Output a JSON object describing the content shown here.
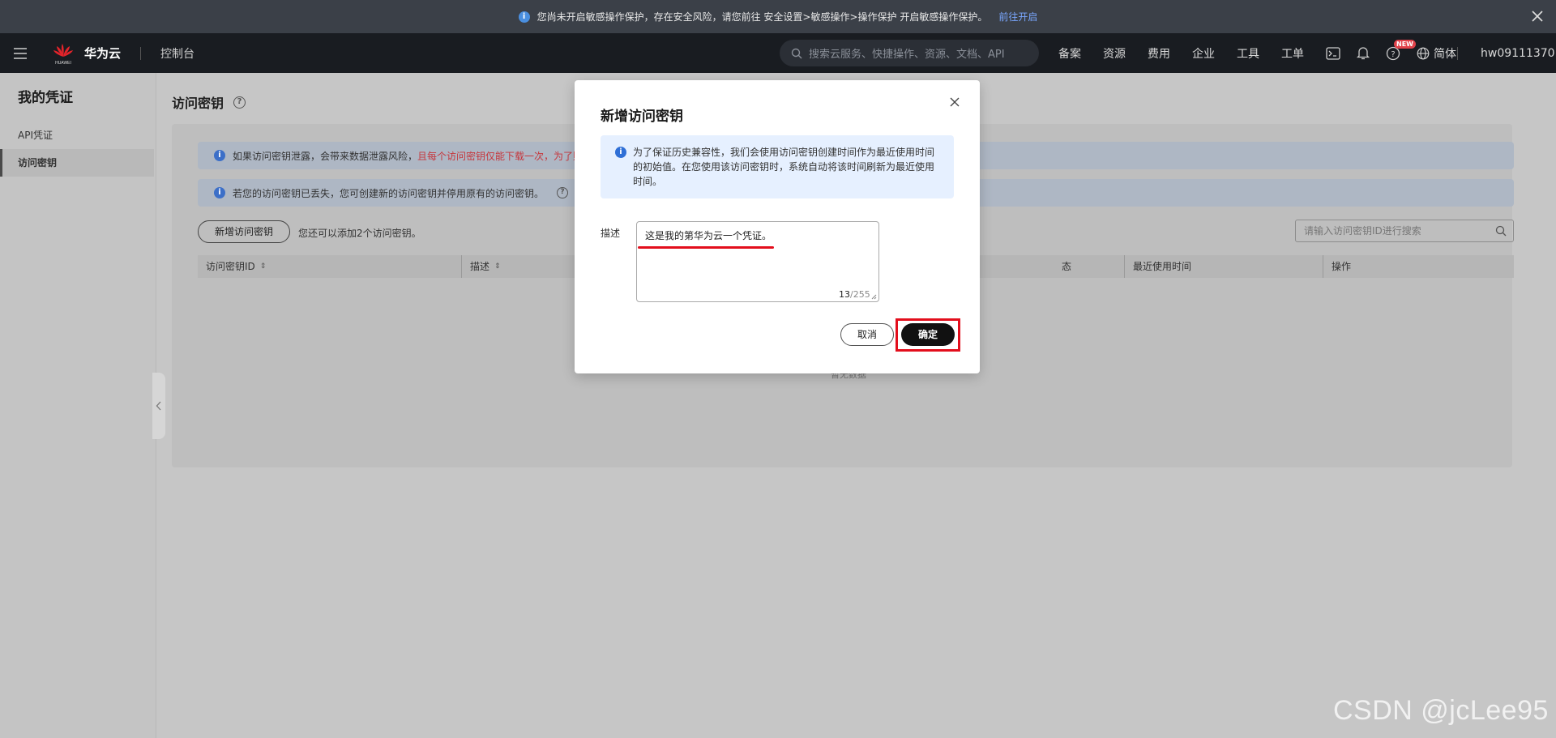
{
  "banner": {
    "message": "您尚未开启敏感操作保护，存在安全风险，请您前往 安全设置>敏感操作>操作保护 开启敏感操作保护。",
    "link": "前往开启"
  },
  "header": {
    "brand": "华为云",
    "logo_text": "HUAWEI",
    "console": "控制台",
    "search_placeholder": "搜索云服务、快捷操作、资源、文档、API",
    "nav": [
      "备案",
      "资源",
      "费用",
      "企业",
      "工具",
      "工单"
    ],
    "new_badge": "NEW",
    "lang": "简体",
    "user": "hw09111370"
  },
  "sidebar": {
    "title": "我的凭证",
    "items": [
      {
        "label": "API凭证"
      },
      {
        "label": "访问密钥"
      }
    ]
  },
  "main": {
    "title": "访问密钥",
    "alert1_prefix": "如果访问密钥泄露，会带来数据泄露风险，",
    "alert1_red": "且每个访问密钥仅能下载一次，为了账",
    "alert2": "若您的访问密钥已丢失，您可创建新的访问密钥并停用原有的访问密钥。",
    "add_button": "新增访问密钥",
    "add_hint": "您还可以添加2个访问密钥。",
    "table_search_placeholder": "请输入访问密钥ID进行搜索",
    "columns": [
      "访问密钥ID",
      "描述",
      "态",
      "最近使用时间",
      "操作"
    ],
    "empty_text": "暂无数据"
  },
  "modal": {
    "title": "新增访问密钥",
    "info": "为了保证历史兼容性，我们会使用访问密钥创建时间作为最近使用时间的初始值。在您使用该访问密钥时，系统自动将该时间刷新为最近使用时间。",
    "desc_label": "描述",
    "desc_value": "这是我的第华为云一个凭证。",
    "char_count": "13",
    "char_max": "/255",
    "cancel": "取消",
    "ok": "确定"
  },
  "watermark": "CSDN @jcLee95",
  "colors": {
    "highlight": "#e30e1c",
    "banner_bg": "#3b4048",
    "header_bg": "#191c21",
    "info_bg": "#e6f0ff"
  }
}
